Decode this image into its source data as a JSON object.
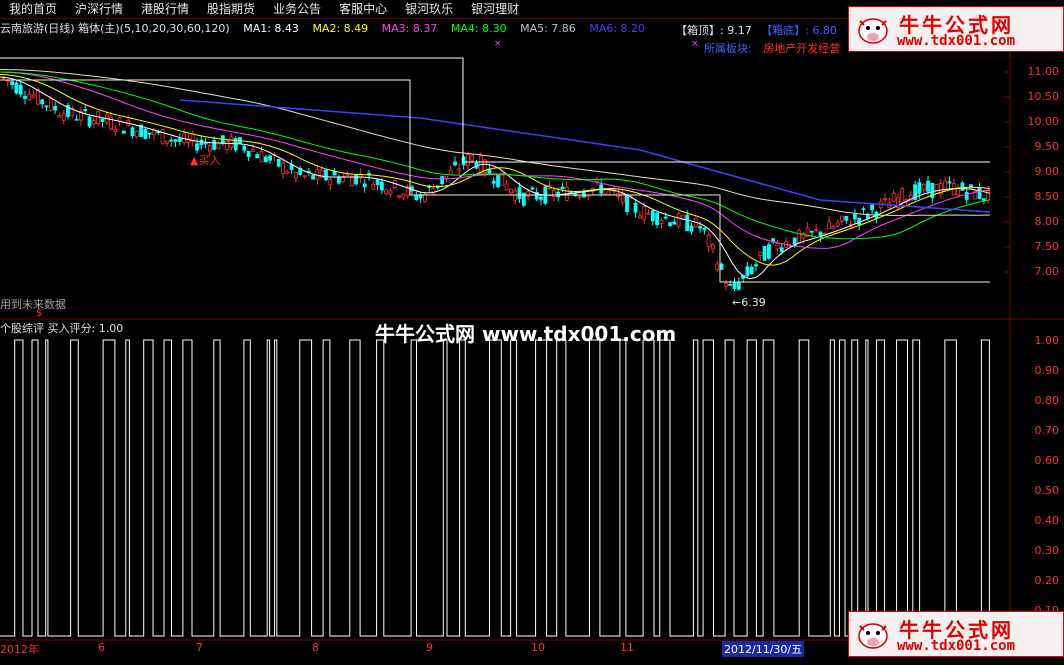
{
  "menu": [
    "我的首页",
    "沪深行情",
    "港股行情",
    "股指期货",
    "业务公告",
    "客服中心",
    "银河玖乐",
    "银河理财"
  ],
  "title": {
    "stock": "云南旅游(日线) 箱体(主)(5,10,20,30,60,120)",
    "ma1": "MA1: 8.43",
    "ma2": "MA2: 8.49",
    "ma3": "MA3: 8.37",
    "ma4": "MA4: 8.30",
    "ma5": "MA5: 7.86",
    "ma6": "MA6: 8.20"
  },
  "colors": {
    "ma1": "#ffffff",
    "ma2": "#ffff00",
    "ma3": "#ff40ff",
    "ma4": "#00ff00",
    "ma5": "#c0c0c0",
    "ma6": "#4040ff",
    "up": "#ff3030",
    "down": "#00ffff"
  },
  "box": {
    "top_label": "【箱顶】: 9.17",
    "bottom_label": "【箱底】: 6.80"
  },
  "sector": {
    "label": "所属板块:",
    "value": "房地产开发经营"
  },
  "buy_mark": "▲买入",
  "low_mark": "←6.39",
  "warning": "用到未来数据",
  "price_axis": [
    "11.00",
    "10.50",
    "10.00",
    "9.50",
    "9.00",
    "8.50",
    "8.00",
    "7.50",
    "7.00"
  ],
  "sub_title": "个股综评  买入评分: 1.00",
  "sub_axis": [
    "1.00",
    "0.90",
    "0.80",
    "0.70",
    "0.60",
    "0.50",
    "0.40",
    "0.30",
    "0.20",
    "0.10"
  ],
  "watermark": "牛牛公式网 www.tdx001.com",
  "logo": {
    "cn": "牛牛公式网",
    "url": "www.tdx001.com"
  },
  "dates": [
    {
      "label": "2012年",
      "pos": 0
    },
    {
      "label": "6",
      "pos": 98
    },
    {
      "label": "7",
      "pos": 196
    },
    {
      "label": "8",
      "pos": 312
    },
    {
      "label": "9",
      "pos": 426
    },
    {
      "label": "10",
      "pos": 531
    },
    {
      "label": "11",
      "pos": 620
    }
  ],
  "cursor_date": "2012/11/30/五"
}
